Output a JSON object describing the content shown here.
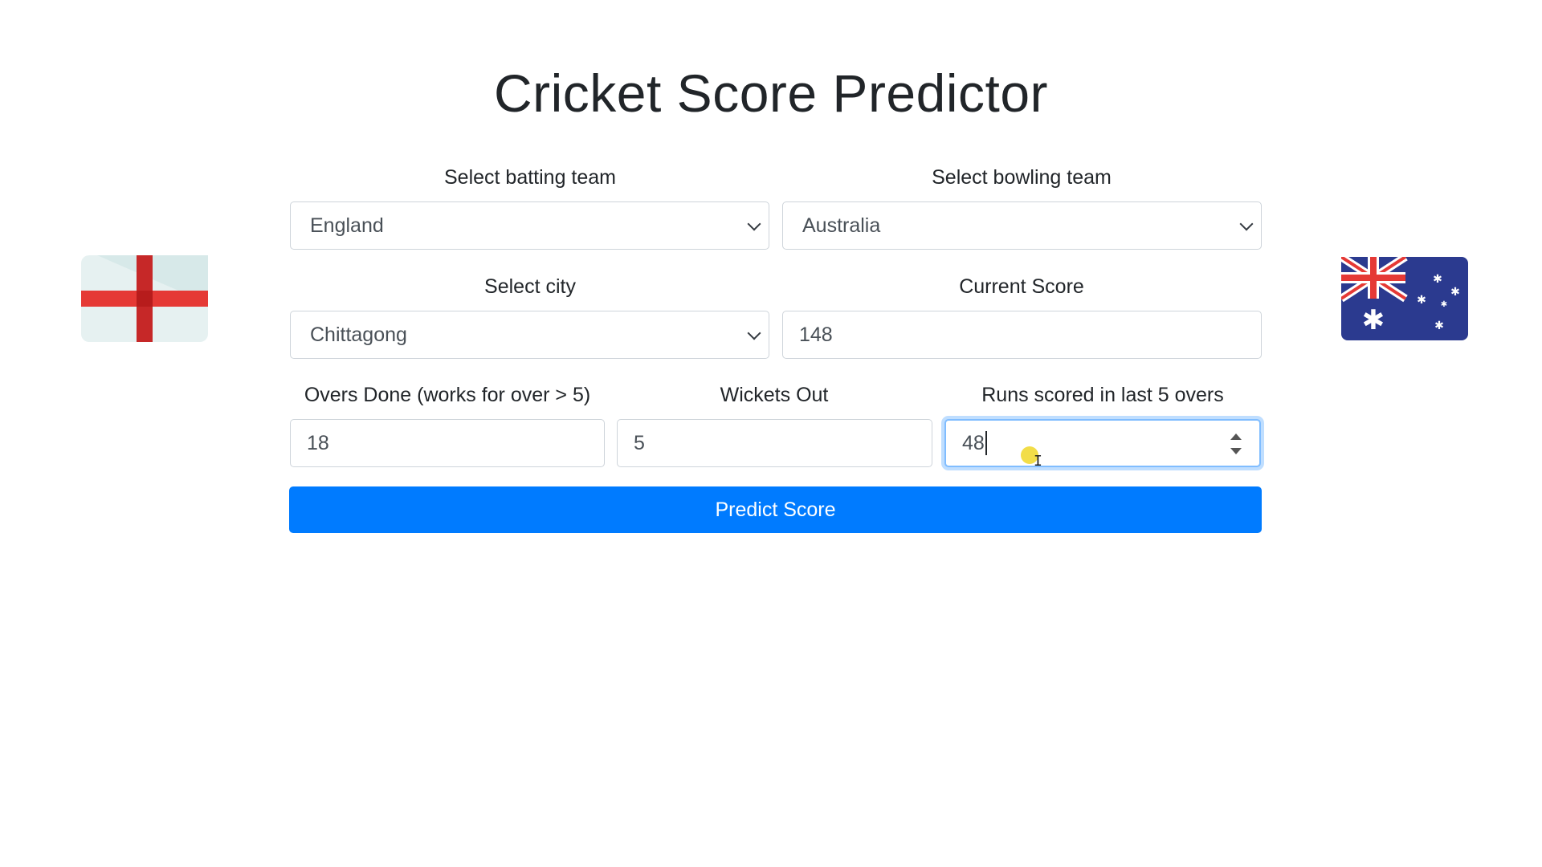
{
  "page": {
    "title": "Cricket Score Predictor"
  },
  "batting_team": {
    "label": "Select batting team",
    "value": "England",
    "flag_icon": "england-flag-icon"
  },
  "bowling_team": {
    "label": "Select bowling team",
    "value": "Australia",
    "flag_icon": "australia-flag-icon"
  },
  "city": {
    "label": "Select city",
    "value": "Chittagong"
  },
  "current_score": {
    "label": "Current Score",
    "value": "148"
  },
  "overs": {
    "label": "Overs Done (works for over > 5)",
    "value": "18"
  },
  "wickets": {
    "label": "Wickets Out",
    "value": "5"
  },
  "last_five": {
    "label": "Runs scored in last 5 overs",
    "value": "48"
  },
  "predict_button": {
    "label": "Predict Score"
  },
  "colors": {
    "primary": "#007bff",
    "focus_border": "#80bdff",
    "england_red": "#d32f2f",
    "australia_blue": "#2b3a8f"
  }
}
